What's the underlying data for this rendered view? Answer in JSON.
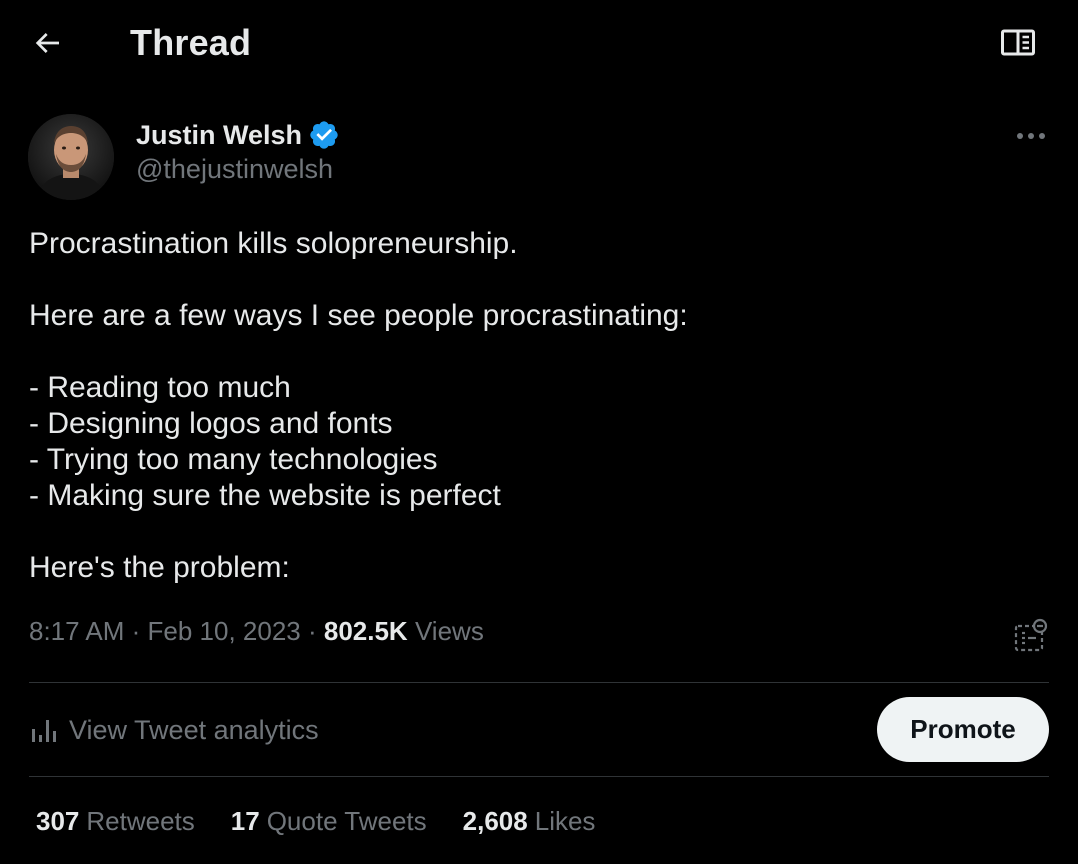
{
  "header": {
    "title": "Thread",
    "back_icon": "arrow-left-icon",
    "reader_icon": "open-book-icon"
  },
  "author": {
    "name": "Justin Welsh",
    "handle": "@thejustinwelsh",
    "verified": true,
    "verified_color": "#1d9bf0"
  },
  "tweet": {
    "lines": [
      "Procrastination kills solopreneurship.",
      "",
      "Here are a few ways I see people procrastinating:",
      "",
      "- Reading too much",
      "- Designing logos and fonts",
      "- Trying too many technologies",
      "- Making sure the website is perfect",
      "",
      "Here's the problem:"
    ]
  },
  "meta": {
    "time": "8:17 AM",
    "separator": " · ",
    "date": "Feb 10, 2023",
    "views_count": "802.5K",
    "views_label": "Views"
  },
  "analytics": {
    "label": "View Tweet analytics",
    "icon": "bar-chart-icon"
  },
  "promote": {
    "label": "Promote"
  },
  "stats": {
    "retweets": {
      "count": "307",
      "label": "Retweets"
    },
    "quotes": {
      "count": "17",
      "label": "Quote Tweets"
    },
    "likes": {
      "count": "2,608",
      "label": "Likes"
    }
  },
  "colors": {
    "background": "#000000",
    "primary_text": "#e7e9ea",
    "secondary_text": "#71767b",
    "divider": "#2f3336",
    "accent": "#1d9bf0",
    "button_bg": "#eff3f4"
  }
}
